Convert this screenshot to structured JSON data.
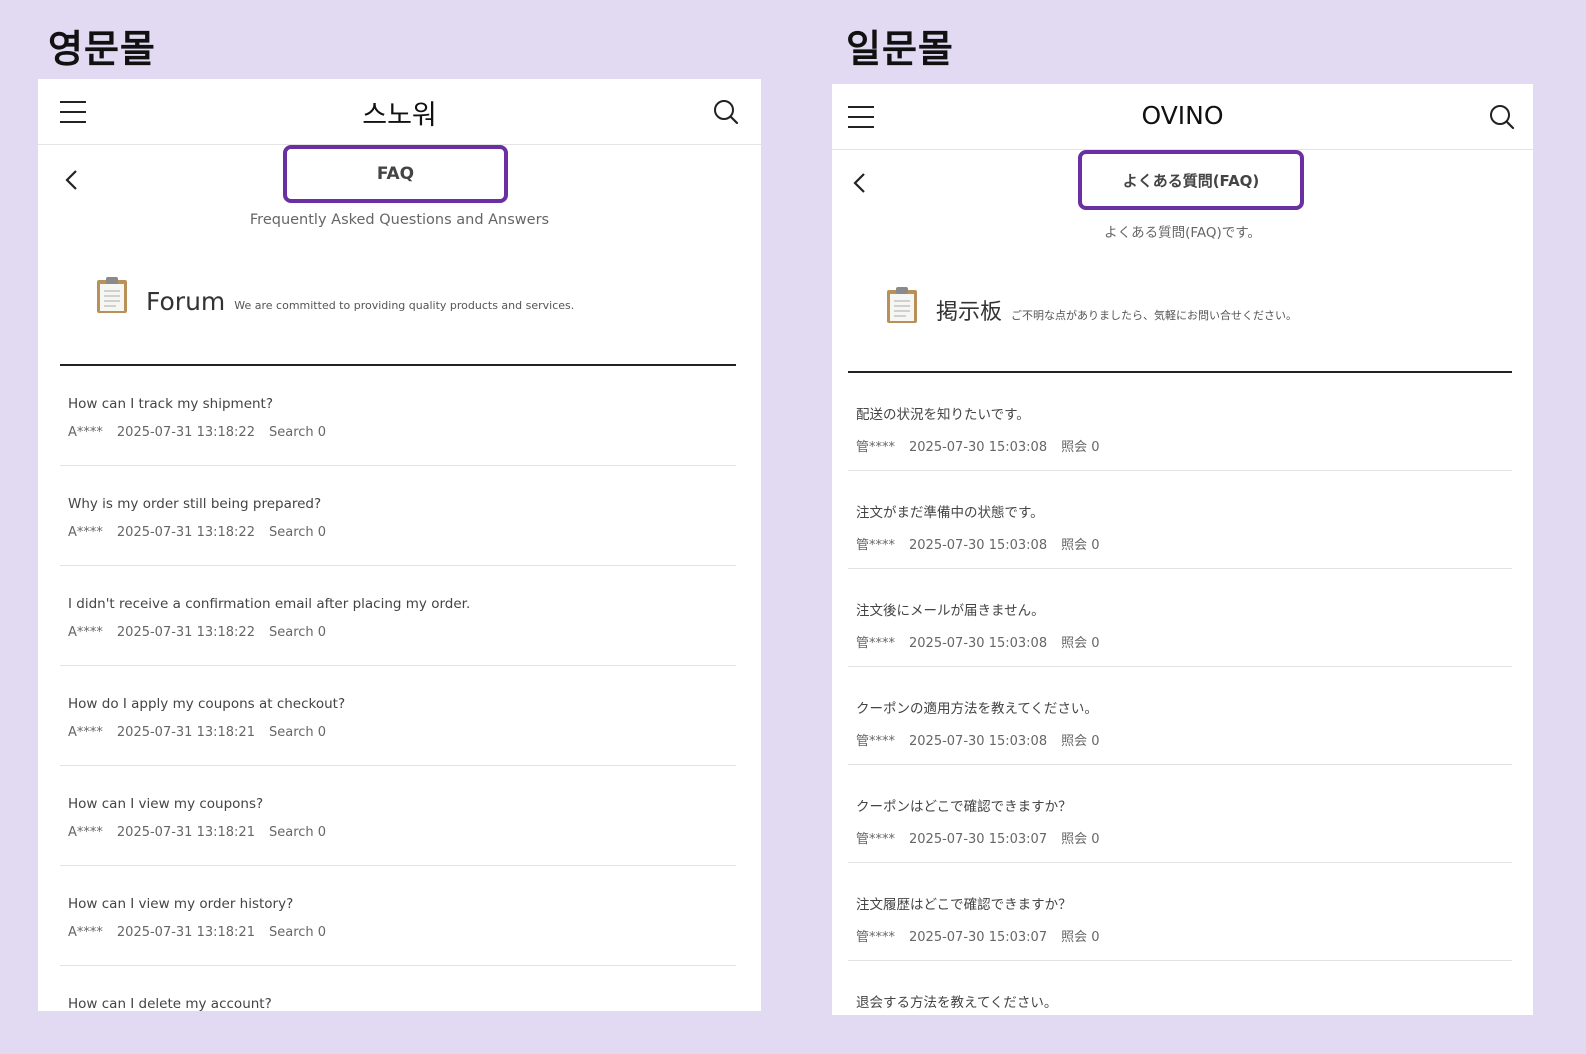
{
  "left": {
    "section_label": "영문몰",
    "brand": "스노워",
    "page_title": "FAQ",
    "subtitle": "Frequently Asked Questions and Answers",
    "board_title": "Forum",
    "board_desc": "We are committed to providing quality products and services.",
    "items": [
      {
        "question": "How can I track my shipment?",
        "author": "A****",
        "date": "2025-07-31 13:18:22",
        "views": "Search 0"
      },
      {
        "question": "Why is my order still being prepared?",
        "author": "A****",
        "date": "2025-07-31 13:18:22",
        "views": "Search 0"
      },
      {
        "question": "I didn't receive a confirmation email after placing my order.",
        "author": "A****",
        "date": "2025-07-31 13:18:22",
        "views": "Search 0"
      },
      {
        "question": "How do I apply my coupons at checkout?",
        "author": "A****",
        "date": "2025-07-31 13:18:21",
        "views": "Search 0"
      },
      {
        "question": "How can I view my coupons?",
        "author": "A****",
        "date": "2025-07-31 13:18:21",
        "views": "Search 0"
      },
      {
        "question": "How can I view my order history?",
        "author": "A****",
        "date": "2025-07-31 13:18:21",
        "views": "Search 0"
      },
      {
        "question": "How can I delete my account?",
        "author": "",
        "date": "",
        "views": ""
      }
    ]
  },
  "right": {
    "section_label": "일문몰",
    "brand": "OVINO",
    "page_title": "よくある質問(FAQ)",
    "subtitle": "よくある質問(FAQ)です。",
    "board_title": "掲示板",
    "board_desc": "ご不明な点がありましたら、気軽にお問い合せください。",
    "items": [
      {
        "question": "配送の状況を知りたいです。",
        "author": "管****",
        "date": "2025-07-30 15:03:08",
        "views": "照会 0"
      },
      {
        "question": "注文がまだ準備中の状態です。",
        "author": "管****",
        "date": "2025-07-30 15:03:08",
        "views": "照会 0"
      },
      {
        "question": "注文後にメールが届きません。",
        "author": "管****",
        "date": "2025-07-30 15:03:08",
        "views": "照会 0"
      },
      {
        "question": "クーポンの適用方法を教えてください。",
        "author": "管****",
        "date": "2025-07-30 15:03:08",
        "views": "照会 0"
      },
      {
        "question": "クーポンはどこで確認できますか？",
        "author": "管****",
        "date": "2025-07-30 15:03:07",
        "views": "照会 0"
      },
      {
        "question": "注文履歴はどこで確認できますか？",
        "author": "管****",
        "date": "2025-07-30 15:03:07",
        "views": "照会 0"
      },
      {
        "question": "退会する方法を教えてください。",
        "author": "",
        "date": "",
        "views": ""
      }
    ]
  },
  "colors": {
    "background": "#e2d9f3",
    "highlight_border": "#6a2fa0"
  },
  "icons": [
    "menu-icon",
    "search-icon",
    "back-icon",
    "clipboard-icon"
  ]
}
